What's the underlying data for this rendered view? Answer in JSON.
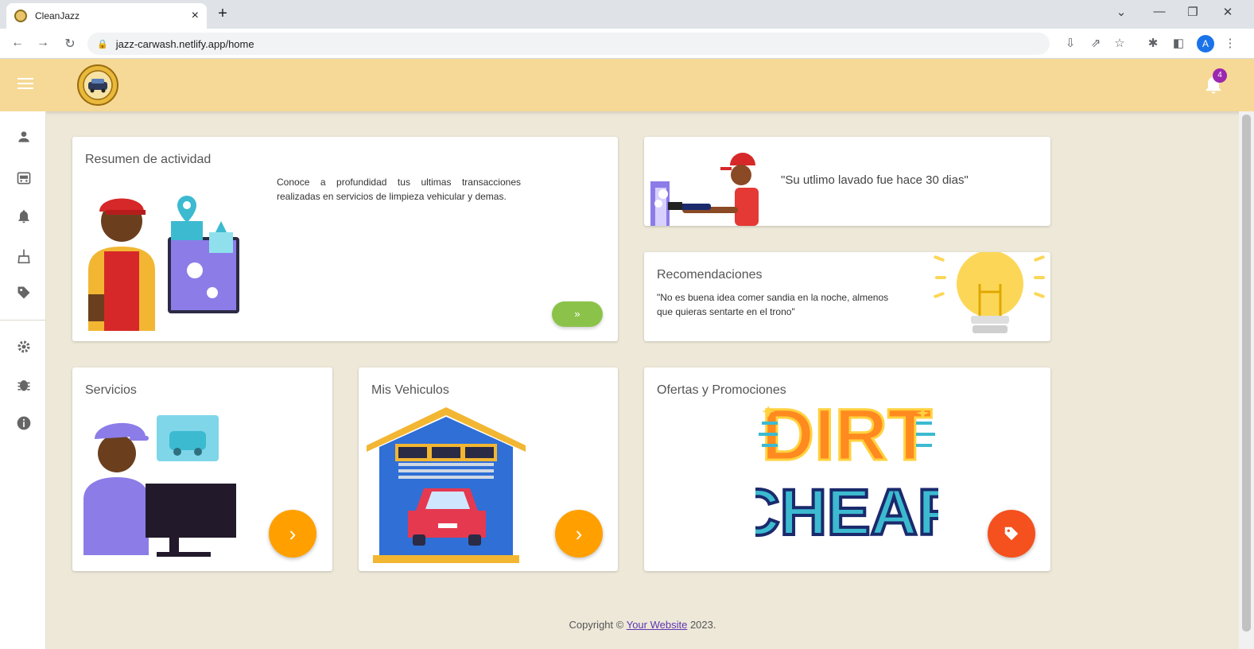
{
  "browser": {
    "tab_title": "CleanJazz",
    "tab_close": "×",
    "new_tab": "+",
    "url": "jazz-carwash.netlify.app/home",
    "profile_initial": "A"
  },
  "header": {
    "notification_count": "4"
  },
  "sidebar": {
    "items": [
      {
        "icon": "person-icon"
      },
      {
        "icon": "car-icon"
      },
      {
        "icon": "bell-icon"
      },
      {
        "icon": "broom-icon"
      },
      {
        "icon": "tag-icon"
      },
      {
        "icon": "gear-icon"
      },
      {
        "icon": "bug-icon"
      },
      {
        "icon": "info-icon"
      }
    ]
  },
  "cards": {
    "activity": {
      "title": "Resumen de actividad",
      "text": "Conoce a profundidad tus ultimas transacciones realizadas en servicios de limpieza vehicular y demas.",
      "button": "»"
    },
    "last_wash": {
      "text": "\"Su utlimo lavado fue hace 30 dias\""
    },
    "recommendations": {
      "title": "Recomendaciones",
      "text": "\"No es buena idea comer sandia en la noche, almenos que quieras sentarte en el trono\""
    },
    "services": {
      "title": "Servicios",
      "button": "›"
    },
    "vehicles": {
      "title": "Mis Vehiculos",
      "button": "›"
    },
    "offers": {
      "title": "Ofertas y Promociones",
      "promo_line1": "DIRT",
      "promo_line2": "CHEAP"
    }
  },
  "footer": {
    "prefix": "Copyright © ",
    "link": "Your Website",
    "suffix": " 2023."
  },
  "colors": {
    "header": "#f6d996",
    "background": "#ede8d8",
    "fab_orange": "#ffa000",
    "fab_red": "#f4511e",
    "pill_green": "#8bc34a",
    "badge_purple": "#9c27b0"
  }
}
